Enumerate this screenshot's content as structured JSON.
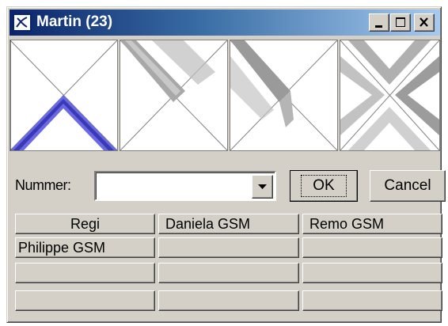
{
  "window": {
    "title": "Martin (23)",
    "colors": {
      "face": "#d4d0c8",
      "title_start": "#0a246a",
      "title_end": "#a6caf0",
      "accent_blue": "#5b5bd6"
    }
  },
  "title_buttons": [
    "minimize-icon",
    "maximize-icon",
    "close-icon"
  ],
  "thumbnails": [
    "x-frame-blue-bottom",
    "x-frame-gray-top-left",
    "x-frame-gray-left",
    "x-frame-gray-four-sides"
  ],
  "number_field": {
    "label": "Nummer:",
    "value": "",
    "dropdown_icon": "dropdown-arrow-icon"
  },
  "buttons": {
    "ok": "OK",
    "cancel": "Cancel"
  },
  "grid": {
    "rows": [
      [
        "Regi",
        "Daniela GSM",
        "Remo GSM"
      ],
      [
        "Philippe GSM",
        "",
        ""
      ],
      [
        "",
        "",
        ""
      ],
      [
        "",
        "",
        ""
      ]
    ]
  }
}
